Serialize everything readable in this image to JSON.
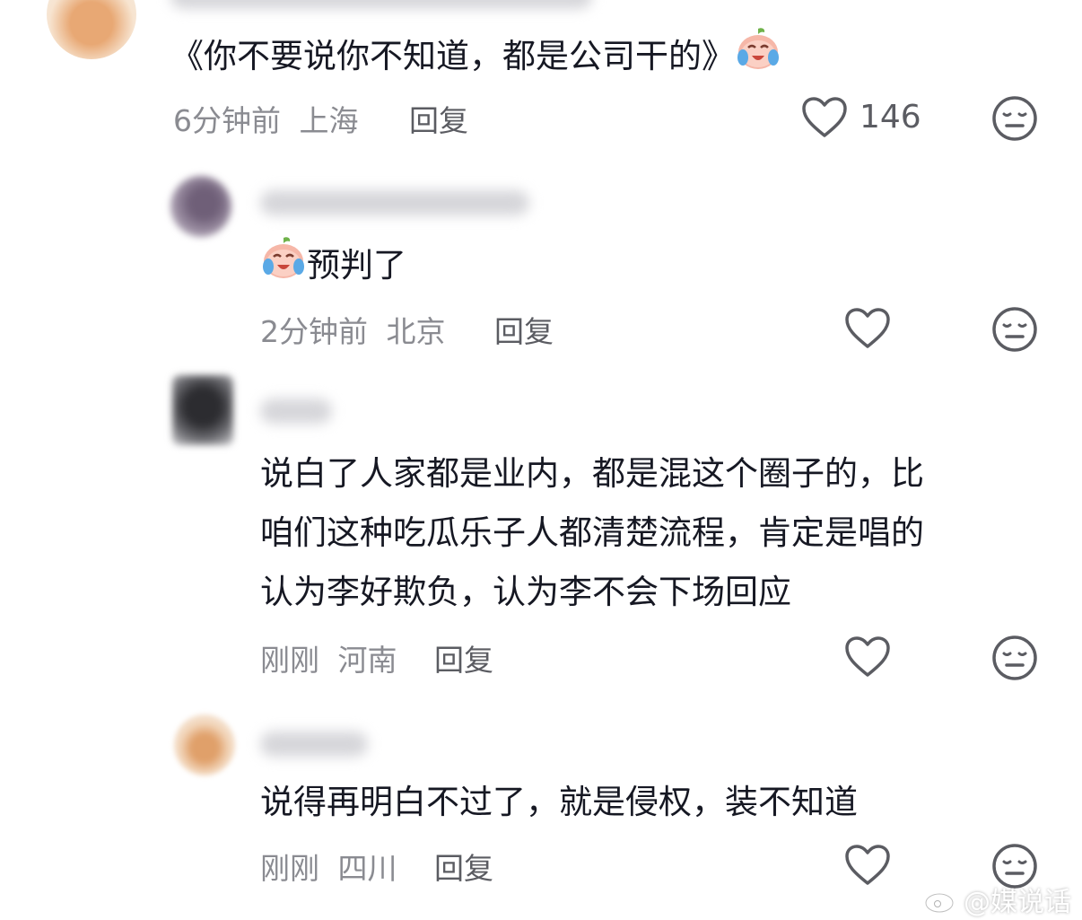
{
  "comments": [
    {
      "text": "《你不要说你不知道，都是公司干的》",
      "time": "6分钟前",
      "location": "上海",
      "reply_label": "回复",
      "likes": "146",
      "emoji": "crying-laughing-peach-emoji"
    },
    {
      "text": "预判了",
      "time": "2分钟前",
      "location": "北京",
      "reply_label": "回复",
      "emoji": "crying-laughing-peach-emoji"
    },
    {
      "lines": [
        "说白了人家都是业内，都是混这个圈子的，比",
        "咱们这种吃瓜乐子人都清楚流程，肯定是唱的",
        "认为李好欺负，认为李不会下场回应"
      ],
      "time": "刚刚",
      "location": "河南",
      "reply_label": "回复"
    },
    {
      "text": "说得再明白不过了，就是侵权，装不知道",
      "time": "刚刚",
      "location": "四川",
      "reply_label": "回复"
    }
  ],
  "watermark": "@媒说话",
  "icons": {
    "like": "heart-outline-icon",
    "dislike": "neutral-face-icon",
    "watermark_logo": "weibo-logo-icon"
  }
}
